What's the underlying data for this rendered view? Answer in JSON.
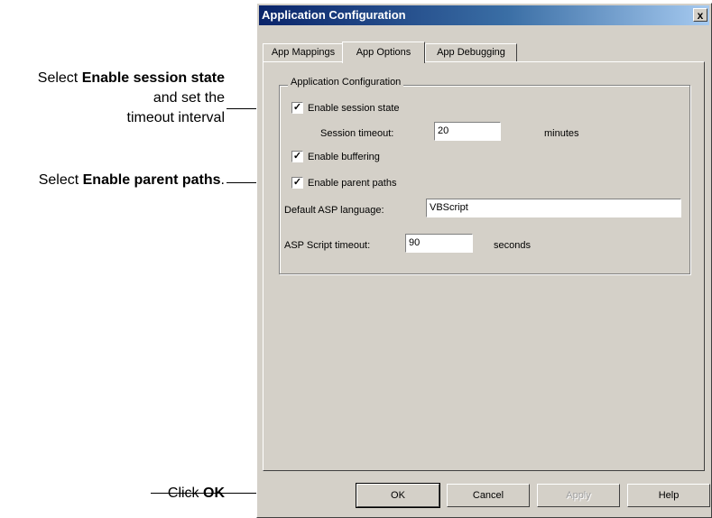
{
  "callouts": {
    "session": {
      "prefix": "Select ",
      "bold": "Enable session state",
      "line2": "and set the",
      "line3": "timeout interval"
    },
    "parent": {
      "prefix": "Select ",
      "bold": "Enable parent paths",
      "suffix": "."
    },
    "ok": {
      "prefix": "Click ",
      "bold": "OK"
    }
  },
  "dialog": {
    "title": "Application Configuration",
    "close_glyph": "x",
    "tabs": [
      "App Mappings",
      "App Options",
      "App Debugging"
    ],
    "active_tab": "App Options",
    "group_title": "Application Configuration",
    "enable_session_state": {
      "label": "Enable session state",
      "checked": true
    },
    "session_timeout": {
      "label": "Session timeout:",
      "value": "20",
      "unit": "minutes"
    },
    "enable_buffering": {
      "label": "Enable buffering",
      "checked": true
    },
    "enable_parent_paths": {
      "label": "Enable parent paths",
      "checked": true
    },
    "default_language": {
      "label": "Default ASP language:",
      "value": "VBScript"
    },
    "script_timeout": {
      "label": "ASP Script timeout:",
      "value": "90",
      "unit": "seconds"
    },
    "buttons": {
      "ok": "OK",
      "cancel": "Cancel",
      "apply": "Apply",
      "help": "Help"
    },
    "check_glyph": "✓"
  }
}
